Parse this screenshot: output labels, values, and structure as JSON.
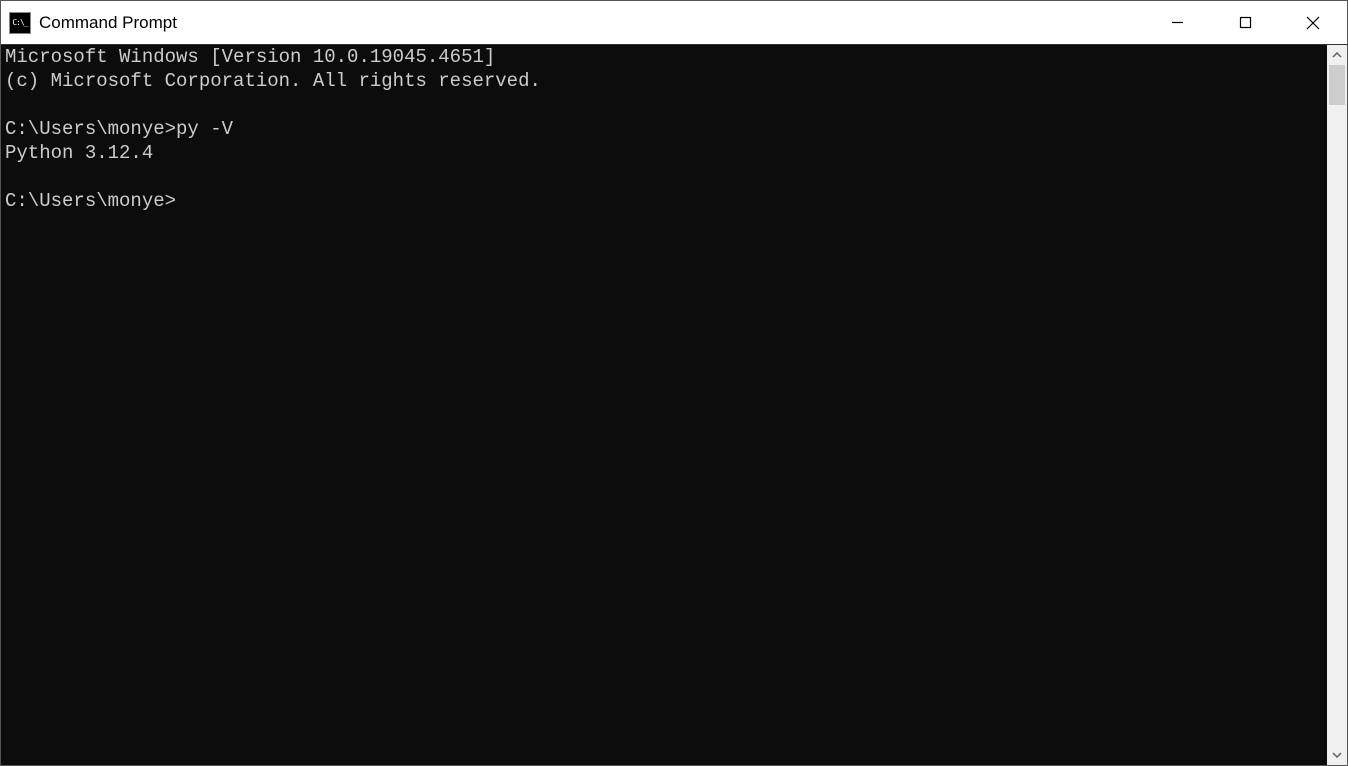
{
  "window": {
    "title": "Command Prompt"
  },
  "terminal": {
    "lines": [
      "Microsoft Windows [Version 10.0.19045.4651]",
      "(c) Microsoft Corporation. All rights reserved.",
      "",
      "C:\\Users\\monye>py -V",
      "Python 3.12.4",
      "",
      "C:\\Users\\monye>"
    ]
  }
}
